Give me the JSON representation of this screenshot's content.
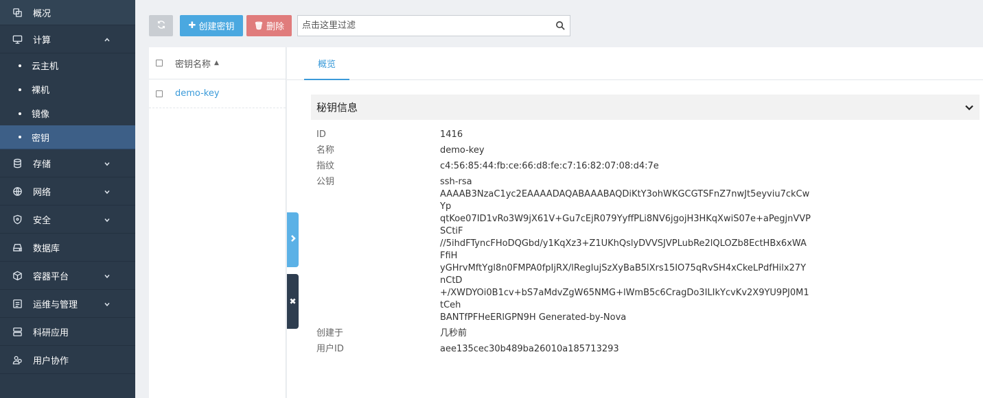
{
  "sidebar": {
    "items": [
      {
        "label": "概况",
        "icon": "overview-icon"
      },
      {
        "label": "计算",
        "icon": "monitor-icon",
        "expanded": true,
        "children": [
          "云主机",
          "裸机",
          "镜像",
          "密钥"
        ],
        "active_child": "密钥"
      },
      {
        "label": "存储",
        "icon": "database-icon"
      },
      {
        "label": "网络",
        "icon": "globe-icon"
      },
      {
        "label": "安全",
        "icon": "shield-icon"
      },
      {
        "label": "数据库",
        "icon": "hdd-icon"
      },
      {
        "label": "容器平台",
        "icon": "cube-icon"
      },
      {
        "label": "运维与管理",
        "icon": "list-icon"
      },
      {
        "label": "科研应用",
        "icon": "server-icon"
      },
      {
        "label": "用户协作",
        "icon": "users-icon"
      }
    ]
  },
  "toolbar": {
    "create_label": "创建密钥",
    "delete_label": "删除",
    "filter_placeholder": "点击这里过滤"
  },
  "list": {
    "header": "密钥名称",
    "rows": [
      {
        "name": "demo-key"
      }
    ]
  },
  "detail": {
    "tab": "概览",
    "section_title": "秘钥信息",
    "props": {
      "id_label": "ID",
      "id_value": "1416",
      "name_label": "名称",
      "name_value": "demo-key",
      "fp_label": "指纹",
      "fp_value": "c4:56:85:44:fb:ce:66:d8:fe:c7:16:82:07:08:d4:7e",
      "pk_label": "公钥",
      "pk_lines": [
        "ssh-rsa",
        "AAAAB3NzaC1yc2EAAAADAQABAAABAQDiKtY3ohWKGCGTSFnZ7nwJt5eyviu7ckCwYp",
        "qtKoe07ID1vRo3W9jX61V+Gu7cEjR079YyffPLi8NV6jgojH3HKqXwiS07e+aPegjnVVPSCtiF",
        "//5ihdFTyncFHoDQGbd/y1KqXz3+Z1UKhQslyDVVSJVPLubRe2lQLOZb8EctHBx6xWAFfiH",
        "yGHrvMftYgl8n0FMPA0fpIjRX/lRegIujSzXyBaB5lXrs15IO75qRvSH4xCkeLPdfHilx27YnCtD",
        "+/XWDYOi0B1cv+bS7aMdvZgW65NMG+lWmB5c6CragDo3ILIkYcvKv2X9YU9PJ0M1tCeh",
        "BANTfPFHeERlGPN9H Generated-by-Nova"
      ],
      "created_label": "创建于",
      "created_value": "几秒前",
      "user_label": "用户ID",
      "user_value": "aee135cec30b489ba26010a185713293"
    }
  }
}
